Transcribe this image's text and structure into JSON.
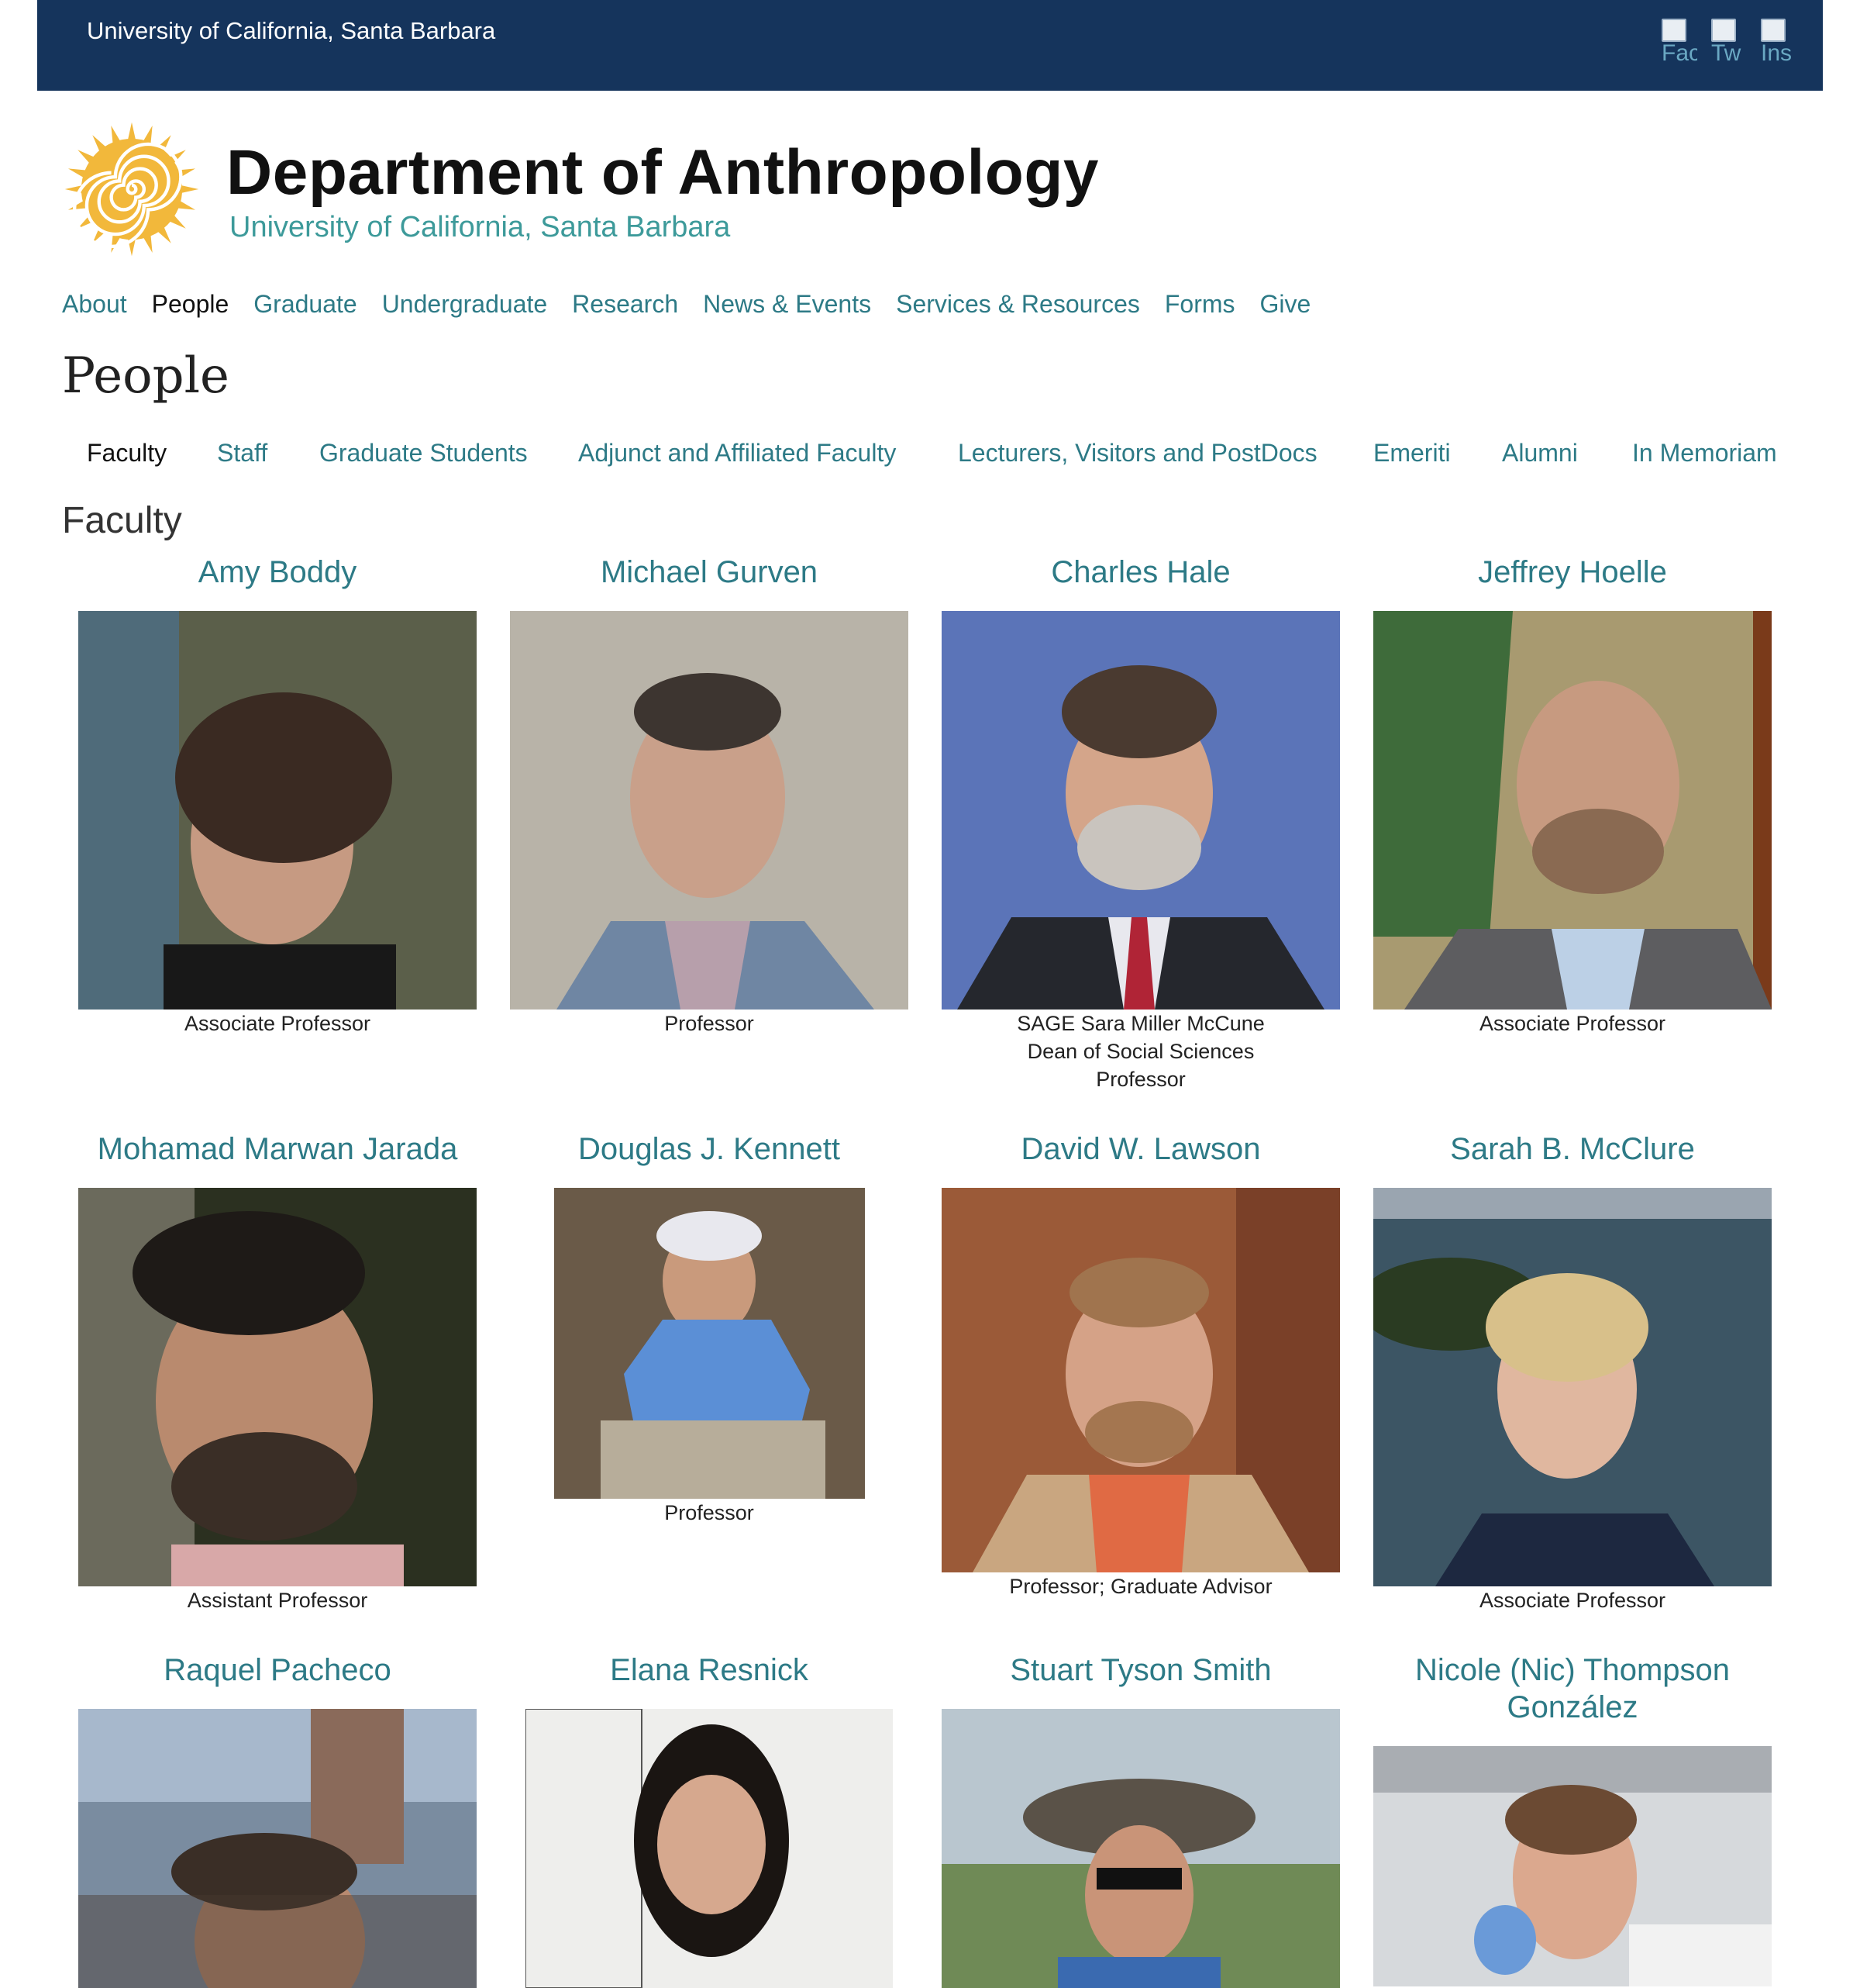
{
  "header": {
    "university": "University of California, Santa Barbara",
    "social": [
      {
        "label": "Fac",
        "icon": "facebook-icon"
      },
      {
        "label": "Tw",
        "icon": "twitter-icon"
      },
      {
        "label": "Ins",
        "icon": "instagram-icon"
      }
    ]
  },
  "branding": {
    "department": "Department of Anthropology",
    "subtitle": "University of California, Santa Barbara",
    "logo_color": "#f2b83b"
  },
  "nav": {
    "items": [
      "About",
      "People",
      "Graduate",
      "Undergraduate",
      "Research",
      "News & Events",
      "Services & Resources",
      "Forms",
      "Give"
    ],
    "active": "People"
  },
  "page": {
    "title": "People"
  },
  "subnav": {
    "items": [
      "Faculty",
      "Staff",
      "Graduate Students",
      "Adjunct and Affiliated Faculty",
      "Lecturers, Visitors and PostDocs",
      "Emeriti",
      "Alumni",
      "In Memoriam"
    ],
    "active": "Faculty"
  },
  "section": {
    "title": "Faculty"
  },
  "faculty": [
    {
      "name": "Amy Boddy",
      "title": "Associate Professor"
    },
    {
      "name": "Michael Gurven",
      "title": "Professor"
    },
    {
      "name": "Charles Hale",
      "title": "SAGE Sara Miller McCune\nDean of Social Sciences\nProfessor"
    },
    {
      "name": "Jeffrey Hoelle",
      "title": "Associate Professor"
    },
    {
      "name": "Mohamad Marwan Jarada",
      "title": "Assistant Professor"
    },
    {
      "name": "Douglas J. Kennett",
      "title": "Professor"
    },
    {
      "name": "David W. Lawson",
      "title": "Professor; Graduate Advisor"
    },
    {
      "name": "Sarah B. McClure",
      "title": "Associate Professor"
    },
    {
      "name": "Raquel Pacheco",
      "title": ""
    },
    {
      "name": "Elana Resnick",
      "title": ""
    },
    {
      "name": "Stuart Tyson Smith",
      "title": ""
    },
    {
      "name": "Nicole (Nic) Thompson González",
      "title": ""
    }
  ],
  "colors": {
    "topbar": "#15345c",
    "link": "#2d7a86"
  }
}
